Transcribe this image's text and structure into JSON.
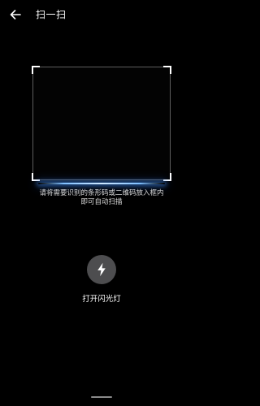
{
  "header": {
    "back_icon": "arrow-left-icon",
    "title": "扫一扫"
  },
  "scanner": {
    "hint_line1": "请将需要识别的条形码或二维码放入框内",
    "hint_line2": "即可自动扫描",
    "scan_line_color": "#7fc0ff",
    "corner_color": "#ffffff"
  },
  "flashlight": {
    "icon": "lightning-bolt-icon",
    "label": "打开闪光灯",
    "button_color": "#4d4d4f"
  },
  "colors": {
    "background": "#000000",
    "text": "#ffffff"
  }
}
